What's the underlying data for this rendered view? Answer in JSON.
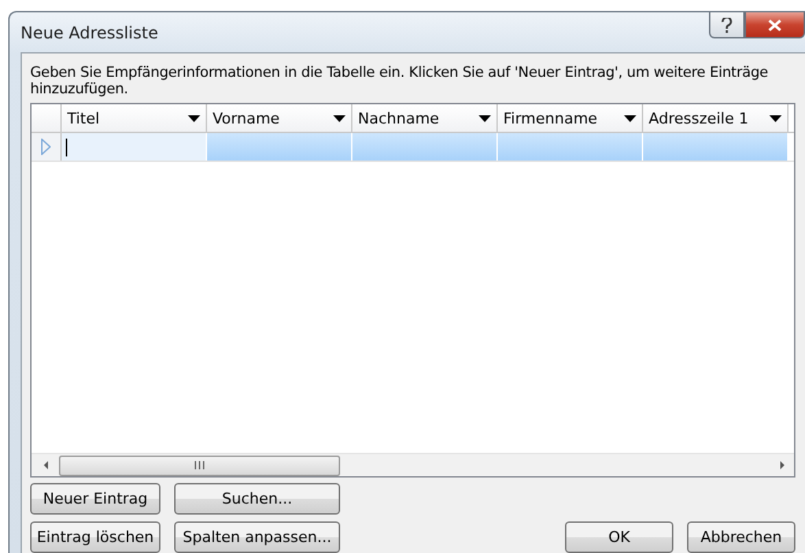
{
  "window": {
    "title": "Neue Adressliste"
  },
  "instructions": "Geben Sie Empfängerinformationen in die Tabelle ein. Klicken Sie auf 'Neuer Eintrag', um weitere Einträge hinzuzufügen.",
  "table": {
    "columns": [
      "Titel",
      "Vorname",
      "Nachname",
      "Firmenname",
      "Adresszeile 1"
    ],
    "rows": [
      {
        "selected": true
      }
    ]
  },
  "buttons_left": [
    [
      "Neuer Eintrag",
      "Suchen..."
    ],
    [
      "Eintrag löschen",
      "Spalten anpassen..."
    ]
  ],
  "buttons_right": [
    "OK",
    "Abbrechen"
  ]
}
